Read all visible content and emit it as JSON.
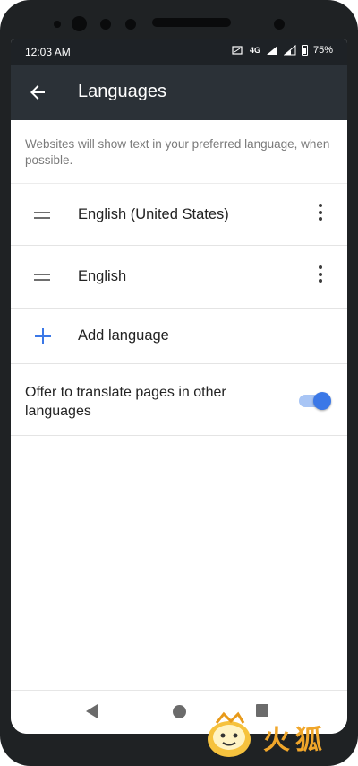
{
  "status_bar": {
    "time": "12:03 AM",
    "network_label": "4G",
    "battery": "75%"
  },
  "app_bar": {
    "title": "Languages",
    "back_icon": "arrow-back-icon"
  },
  "description": "Websites will show text in your preferred language, when possible.",
  "languages": [
    {
      "label": "English (United States)",
      "drag_icon": "drag-handle-icon",
      "menu_icon": "more-vert-icon"
    },
    {
      "label": "English",
      "drag_icon": "drag-handle-icon",
      "menu_icon": "more-vert-icon"
    }
  ],
  "add_language": {
    "label": "Add language",
    "icon": "plus-icon"
  },
  "translate_setting": {
    "label": "Offer to translate pages in other languages",
    "enabled": true
  },
  "colors": {
    "accent": "#3b78e7",
    "app_bar": "#2b3137",
    "status_bar": "#1e2226"
  },
  "nav_bar": {
    "icons": [
      "nav-back-icon",
      "nav-home-icon",
      "nav-recents-icon"
    ]
  }
}
